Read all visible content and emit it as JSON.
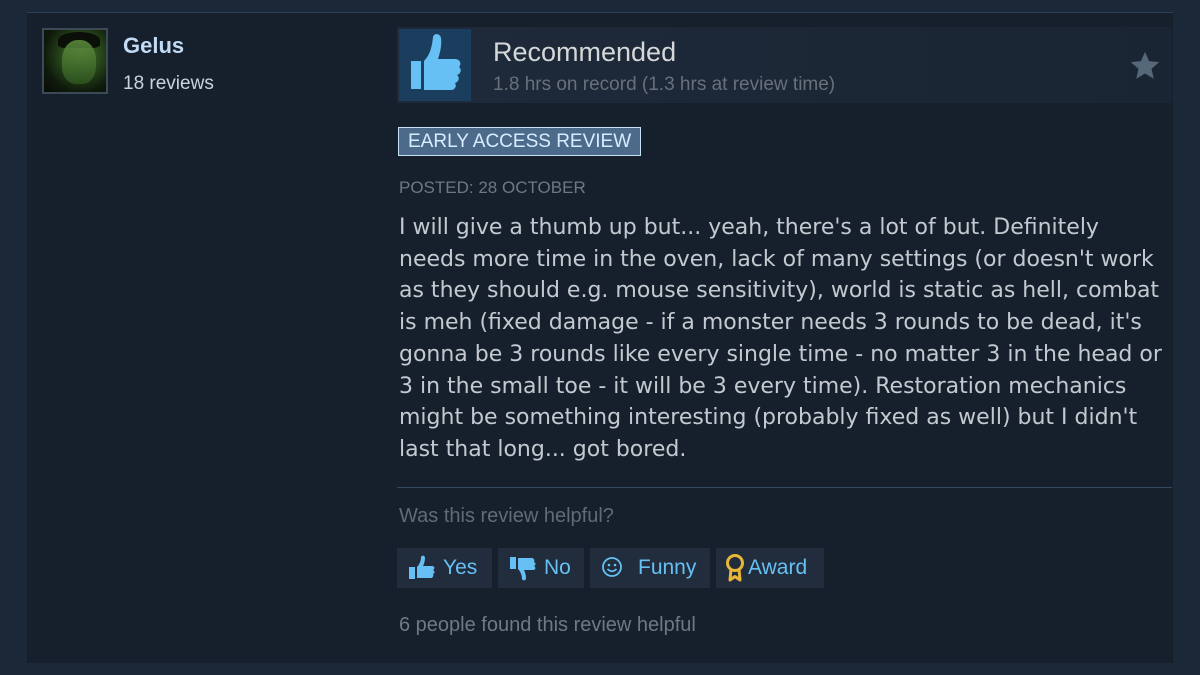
{
  "user": {
    "name": "Gelus",
    "reviews": "18 reviews",
    "avatar_icon": "hulk-avatar"
  },
  "review": {
    "verdict": "Recommended",
    "hours": "1.8 hrs on record (1.3 hrs at review time)",
    "badge": "EARLY ACCESS REVIEW",
    "posted": "POSTED: 28 OCTOBER",
    "text": "I will give a thumb up but... yeah, there's a lot of but. Definitely needs more time in the oven, lack of many settings (or doesn't work as they should e.g. mouse sensitivity), world is static as hell, combat is meh (fixed damage - if a monster needs 3 rounds to be dead, it's gonna be 3 rounds like every single time - no matter 3 in the head or 3 in the small toe - it will be 3 every time). Restoration mechanics might be something interesting (probably fixed as well) but I didn't last that long... got bored."
  },
  "feedback": {
    "question": "Was this review helpful?",
    "buttons": [
      {
        "label": "Yes",
        "icon": "thumbs-up-icon"
      },
      {
        "label": "No",
        "icon": "thumbs-down-icon"
      },
      {
        "label": "Funny",
        "icon": "smiley-icon"
      },
      {
        "label": "Award",
        "icon": "award-icon"
      }
    ],
    "helpful_count": "6 people found this review helpful"
  },
  "colors": {
    "background": "#1b2838",
    "accent": "#66c0f4",
    "thumb_box": "#1c3e5e"
  }
}
